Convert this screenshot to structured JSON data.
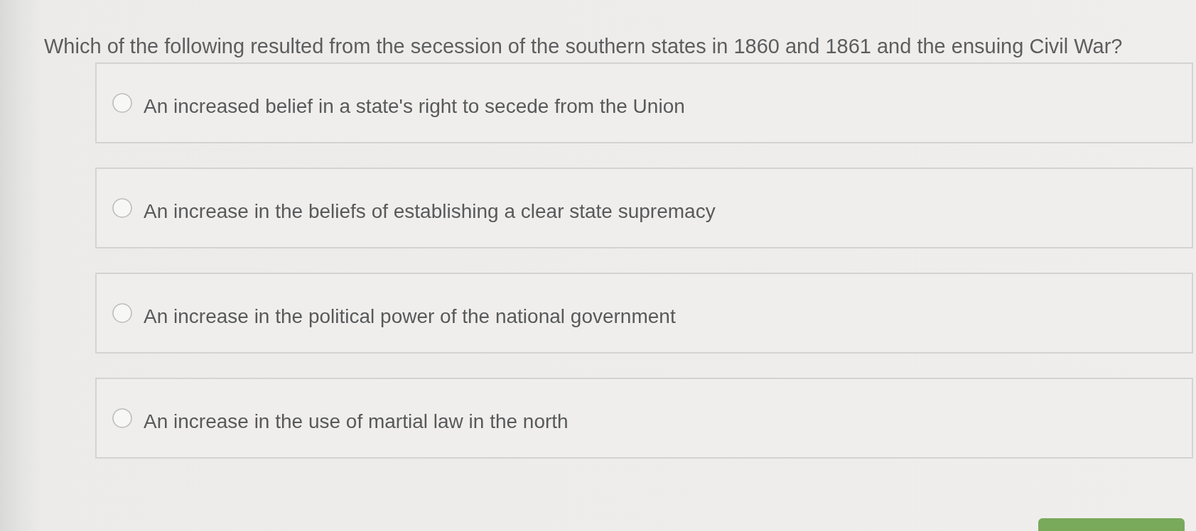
{
  "question": {
    "text": "Which of the following resulted from the secession of the southern states in 1860 and 1861 and the ensuing Civil War?"
  },
  "options": [
    {
      "label": "An increased belief in a state's right to secede from the Union",
      "selected": false
    },
    {
      "label": "An increase in the beliefs of establishing a clear state supremacy",
      "selected": false
    },
    {
      "label": "An increase in the political power of the national government",
      "selected": false
    },
    {
      "label": "An increase in the use of martial law in the north",
      "selected": false
    }
  ]
}
